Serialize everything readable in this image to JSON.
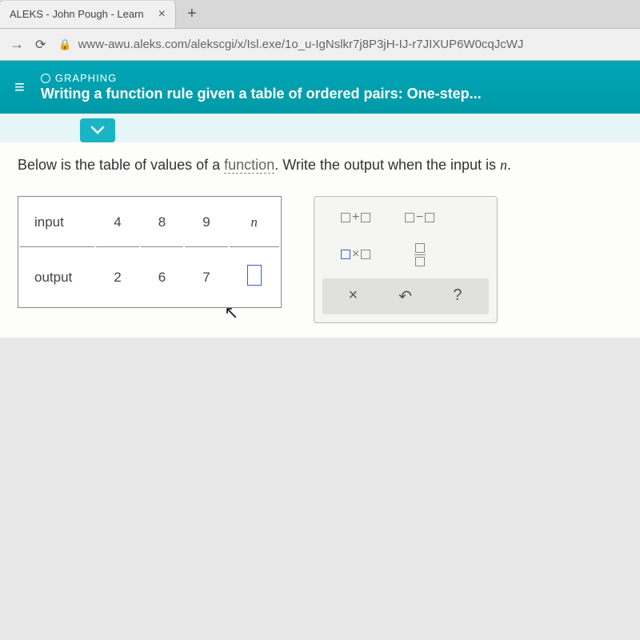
{
  "browser": {
    "tab_title": "ALEKS - John Pough - Learn",
    "url": "www-awu.aleks.com/alekscgi/x/Isl.exe/1o_u-IgNslkr7j8P3jH-IJ-r7JIXUP6W0cqJcWJ"
  },
  "header": {
    "category": "GRAPHING",
    "title": "Writing a function rule given a table of ordered pairs: One-step..."
  },
  "problem": {
    "prefix": "Below is the table of values of a ",
    "function_word": "function",
    "suffix": ". Write the output when the input is ",
    "variable": "n",
    "end": "."
  },
  "table": {
    "row_labels": [
      "input",
      "output"
    ],
    "inputs": [
      "4",
      "8",
      "9",
      "n"
    ],
    "outputs": [
      "2",
      "6",
      "7",
      ""
    ]
  },
  "tools": {
    "add": "+",
    "sub": "−",
    "mul": "×",
    "clear": "×",
    "undo": "↶",
    "help": "?"
  }
}
